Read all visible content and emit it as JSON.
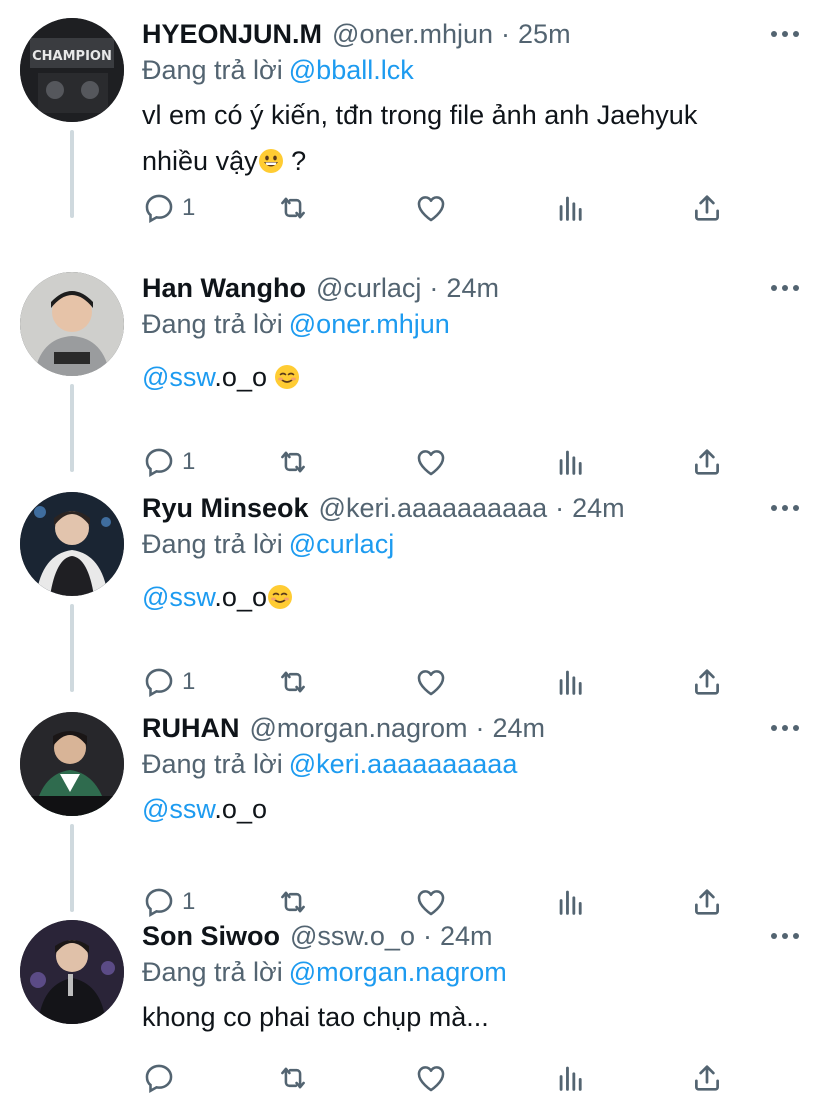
{
  "colors": {
    "link": "#1d9bf0",
    "secondary_text": "#536471",
    "primary_text": "#0f1419",
    "thread_line": "#cfd9de"
  },
  "thread": [
    {
      "display_name": "HYEONJUN.M",
      "handle": "@oner.mhjun",
      "separator": "·",
      "time": "25m",
      "reply_prefix": "Đang trả lời",
      "reply_to": "@bball.lck",
      "body_lines": [
        "vl em có ý kiến, tđn trong file ảnh anh Jaehyuk",
        "nhiều vậy",
        " ?"
      ],
      "reply_count": "1",
      "avatar_icon": "champion-jersey-photo"
    },
    {
      "display_name": "Han Wangho",
      "handle": "@curlacj",
      "separator": "·",
      "time": "24m",
      "reply_prefix": "Đang trả lời",
      "reply_to": "@oner.mhjun",
      "body_mention": "@ssw",
      "body_text": ".o_o ",
      "reply_count": "1",
      "avatar_icon": "person-hoodie-photo"
    },
    {
      "display_name": "Ryu Minseok",
      "handle": "@keri.aaaaaaaaaa",
      "separator": "·",
      "time": "24m",
      "reply_prefix": "Đang trả lời",
      "reply_to": "@curlacj",
      "body_mention": "@ssw",
      "body_text": ".o_o",
      "reply_count": "1",
      "avatar_icon": "person-stage-photo"
    },
    {
      "display_name": "RUHAN",
      "handle": "@morgan.nagrom",
      "separator": "·",
      "time": "24m",
      "reply_prefix": "Đang trả lời",
      "reply_to": "@keri.aaaaaaaaaa",
      "body_mention": "@ssw",
      "body_text": ".o_o",
      "reply_count": "1",
      "avatar_icon": "person-jersey-photo"
    },
    {
      "display_name": "Son Siwoo",
      "handle": "@ssw.o_o",
      "separator": "·",
      "time": "24m",
      "reply_prefix": "Đang trả lời",
      "reply_to": "@morgan.nagrom",
      "body_text": "khong co phai tao chụp mà...",
      "reply_count": "",
      "avatar_icon": "person-microphone-photo"
    }
  ]
}
